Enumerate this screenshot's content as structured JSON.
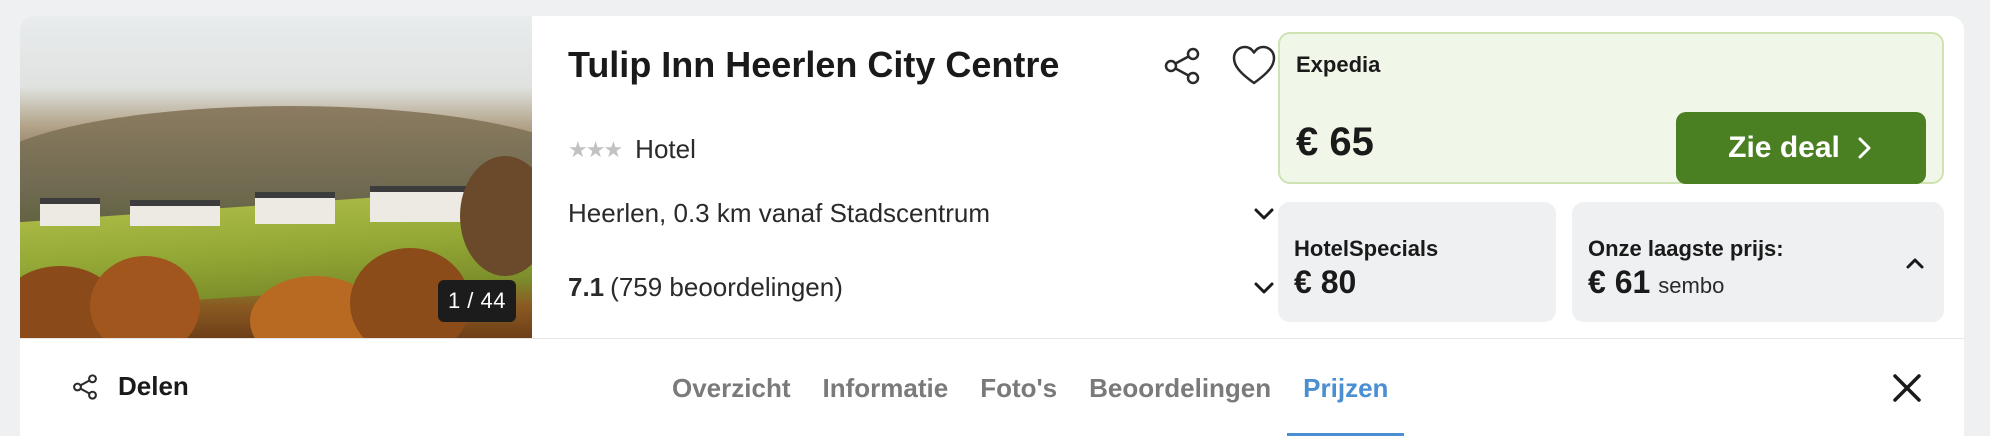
{
  "photo": {
    "counter": "1 / 44"
  },
  "hotel": {
    "name": "Tulip Inn Heerlen City Centre",
    "stars": "★★★",
    "type": "Hotel",
    "location": "Heerlen, 0.3 km vanaf Stadscentrum",
    "rating_score": "7.1",
    "rating_count": "(759 beoordelingen)"
  },
  "deals": {
    "main": {
      "provider": "Expedia",
      "price": "€ 65",
      "button_label": "Zie deal"
    },
    "secondary": {
      "provider": "HotelSpecials",
      "price": "€ 80"
    },
    "lowest": {
      "label": "Onze laagste prijs:",
      "price": "€ 61",
      "provider": "sembo"
    }
  },
  "bottom_bar": {
    "share_label": "Delen",
    "tabs": [
      {
        "label": "Overzicht",
        "active": false
      },
      {
        "label": "Informatie",
        "active": false
      },
      {
        "label": "Foto's",
        "active": false
      },
      {
        "label": "Beoordelingen",
        "active": false
      },
      {
        "label": "Prijzen",
        "active": true
      }
    ]
  },
  "icons": {
    "share": "share-icon",
    "heart": "heart-icon",
    "chevron_down": "chevron-down-icon",
    "chevron_up": "chevron-up-icon",
    "chevron_right": "chevron-right-icon",
    "close": "close-icon"
  },
  "colors": {
    "deal_button": "#4a7f22",
    "deal_bg": "#f1f7e8",
    "active_tab": "#4a8fd1"
  }
}
